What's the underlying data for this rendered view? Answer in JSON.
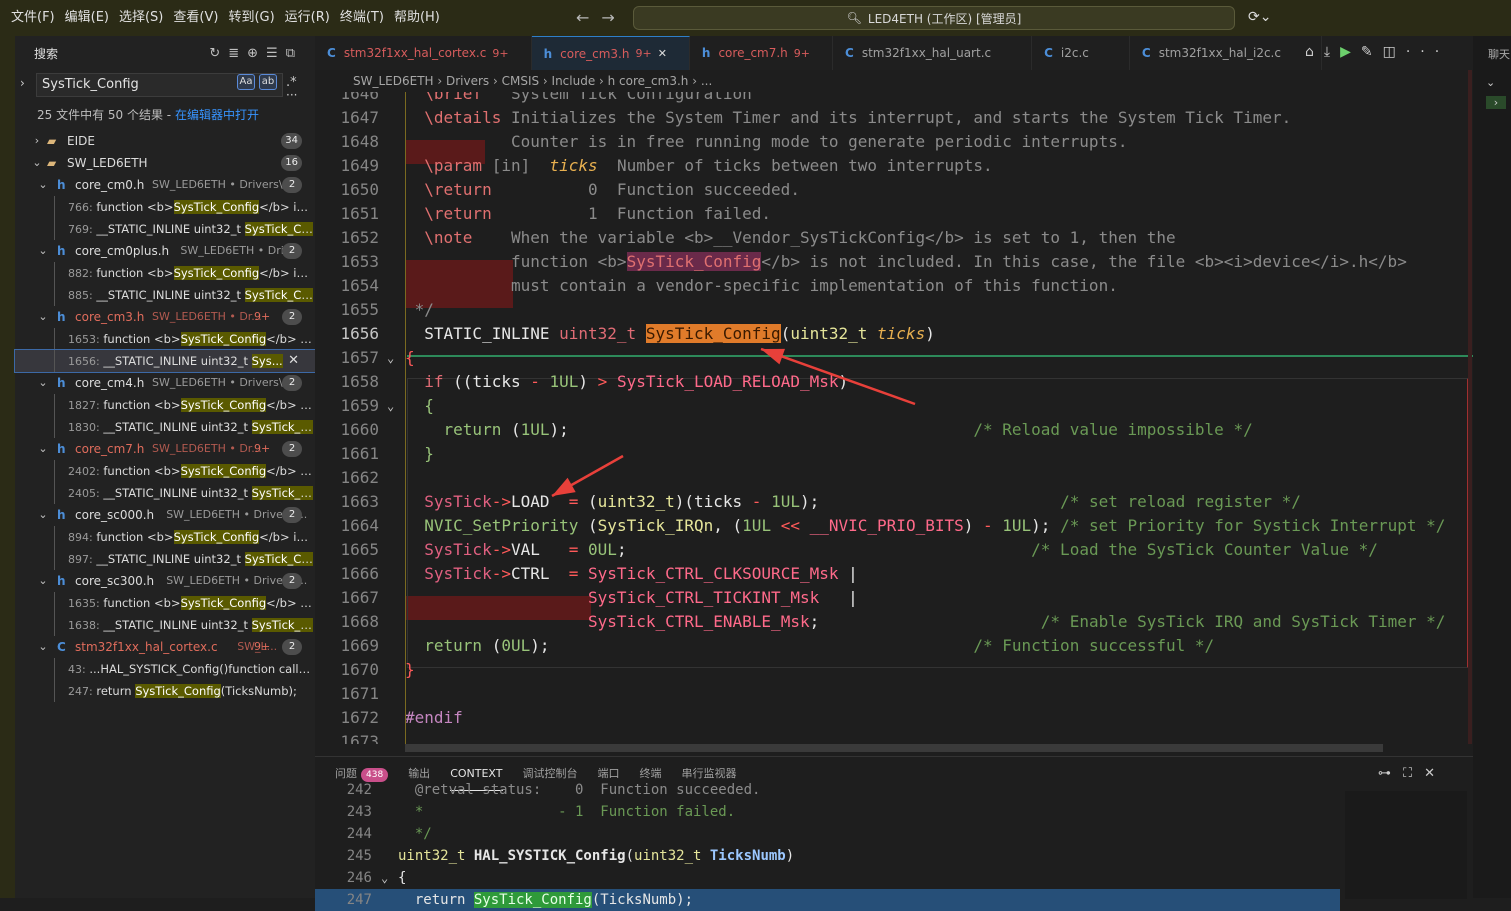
{
  "menu": [
    "文件(F)",
    "编辑(E)",
    "选择(S)",
    "查看(V)",
    "转到(G)",
    "运行(R)",
    "终端(T)",
    "帮助(H)"
  ],
  "command_center": "LED4ETH (工作区) [管理员]",
  "sidebar": {
    "title": "搜索",
    "search_value": "SysTick_Config",
    "opt_case": "Aa",
    "opt_word": "ab",
    "summary": "25 文件中有 50 个结果 - ",
    "open_in_editor": "在编辑器中打开",
    "folders": [
      {
        "name": "EIDE",
        "count": "34"
      },
      {
        "name": "SW_LED6ETH",
        "count": "16"
      }
    ],
    "files": [
      {
        "name": "core_cm0.h",
        "path": "SW_LED6ETH • Drivers\\C...",
        "count": "2",
        "mod": "",
        "matches": [
          {
            "ln": "766:",
            "pre": " function <b>",
            "hit": "SysTick_Config",
            "post": "</b> is ..."
          },
          {
            "ln": "769:",
            "pre": " __STATIC_INLINE uint32_t ",
            "hit": "SysTick_Co...",
            "post": ""
          }
        ]
      },
      {
        "name": "core_cm0plus.h",
        "path": "SW_LED6ETH • Driv...",
        "count": "2",
        "mod": "",
        "matches": [
          {
            "ln": "882:",
            "pre": " function <b>",
            "hit": "SysTick_Config",
            "post": "</b> is ..."
          },
          {
            "ln": "885:",
            "pre": " __STATIC_INLINE uint32_t ",
            "hit": "SysTick_Co...",
            "post": ""
          }
        ]
      },
      {
        "name": "core_cm3.h",
        "path": "SW_LED6ETH • Dr...",
        "count": "2",
        "mod": "9+",
        "matches": [
          {
            "ln": "1653:",
            "pre": " function <b>",
            "hit": "SysTick_Config",
            "post": "</b> is..."
          },
          {
            "ln": "1656:",
            "pre": " __STATIC_INLINE uint32_t ",
            "hit": "Sys...",
            "post": ""
          }
        ]
      },
      {
        "name": "core_cm4.h",
        "path": "SW_LED6ETH • Drivers\\C...",
        "count": "2",
        "mod": "",
        "matches": [
          {
            "ln": "1827:",
            "pre": " function <b>",
            "hit": "SysTick_Config",
            "post": "</b> is..."
          },
          {
            "ln": "1830:",
            "pre": " __STATIC_INLINE uint32_t ",
            "hit": "SysTick_C...",
            "post": ""
          }
        ]
      },
      {
        "name": "core_cm7.h",
        "path": "SW_LED6ETH • Dr...",
        "count": "2",
        "mod": "9+",
        "matches": [
          {
            "ln": "2402:",
            "pre": " function <b>",
            "hit": "SysTick_Config",
            "post": "</b> is..."
          },
          {
            "ln": "2405:",
            "pre": " __STATIC_INLINE uint32_t ",
            "hit": "SysTick_C...",
            "post": ""
          }
        ]
      },
      {
        "name": "core_sc000.h",
        "path": "SW_LED6ETH • Drivers\\...",
        "count": "2",
        "mod": "",
        "matches": [
          {
            "ln": "894:",
            "pre": " function <b>",
            "hit": "SysTick_Config",
            "post": "</b> is ..."
          },
          {
            "ln": "897:",
            "pre": " __STATIC_INLINE uint32_t ",
            "hit": "SysTick_Co...",
            "post": ""
          }
        ]
      },
      {
        "name": "core_sc300.h",
        "path": "SW_LED6ETH • Drivers\\...",
        "count": "2",
        "mod": "",
        "matches": [
          {
            "ln": "1635:",
            "pre": " function <b>",
            "hit": "SysTick_Config",
            "post": "</b> is..."
          },
          {
            "ln": "1638:",
            "pre": " __STATIC_INLINE uint32_t ",
            "hit": "SysTick_C...",
            "post": ""
          }
        ]
      },
      {
        "name": "stm32f1xx_hal_cortex.c",
        "path": "SW_L...",
        "count": "2",
        "mod": "9+",
        "matches": [
          {
            "ln": "43:",
            "pre": " ...HAL_SYSTICK_Config()function calls ...",
            "hit": "",
            "post": ""
          },
          {
            "ln": "247:",
            "pre": " return ",
            "hit": "SysTick_Config",
            "post": "(TicksNumb);"
          }
        ]
      }
    ]
  },
  "tabs": [
    {
      "icon": "C",
      "name": "stm32f1xx_hal_cortex.c",
      "badge": "9+"
    },
    {
      "icon": "h",
      "name": "core_cm3.h",
      "badge": "9+"
    },
    {
      "icon": "h",
      "name": "core_cm7.h",
      "badge": "9+"
    },
    {
      "icon": "C",
      "name": "stm32f1xx_hal_uart.c",
      "badge": ""
    },
    {
      "icon": "C",
      "name": "i2c.c",
      "badge": ""
    },
    {
      "icon": "C",
      "name": "stm32f1xx_hal_i2c.c",
      "badge": ""
    }
  ],
  "breadcrumb": "SW_LED6ETH  ›  Drivers  ›  CMSIS  ›  Include  ›  h  core_cm3.h  ›  ...",
  "right_label": "聊天",
  "editor_lines": [
    "1646",
    "1647",
    "1648",
    "1649",
    "1650",
    "1651",
    "1652",
    "1653",
    "1654",
    "1655",
    "1656",
    "1657",
    "1658",
    "1659",
    "1660",
    "1661",
    "1662",
    "1663",
    "1664",
    "1665",
    "1666",
    "1667",
    "1668",
    "1669",
    "1670",
    "1671",
    "1672",
    "1673"
  ],
  "panel": {
    "tabs": [
      "问题",
      "输出",
      "CONTEXT",
      "调试控制台",
      "端口",
      "终端",
      "串行监视器"
    ],
    "problems_count": "438",
    "lines": [
      "242",
      "243",
      "244",
      "245",
      "246",
      "247"
    ]
  }
}
